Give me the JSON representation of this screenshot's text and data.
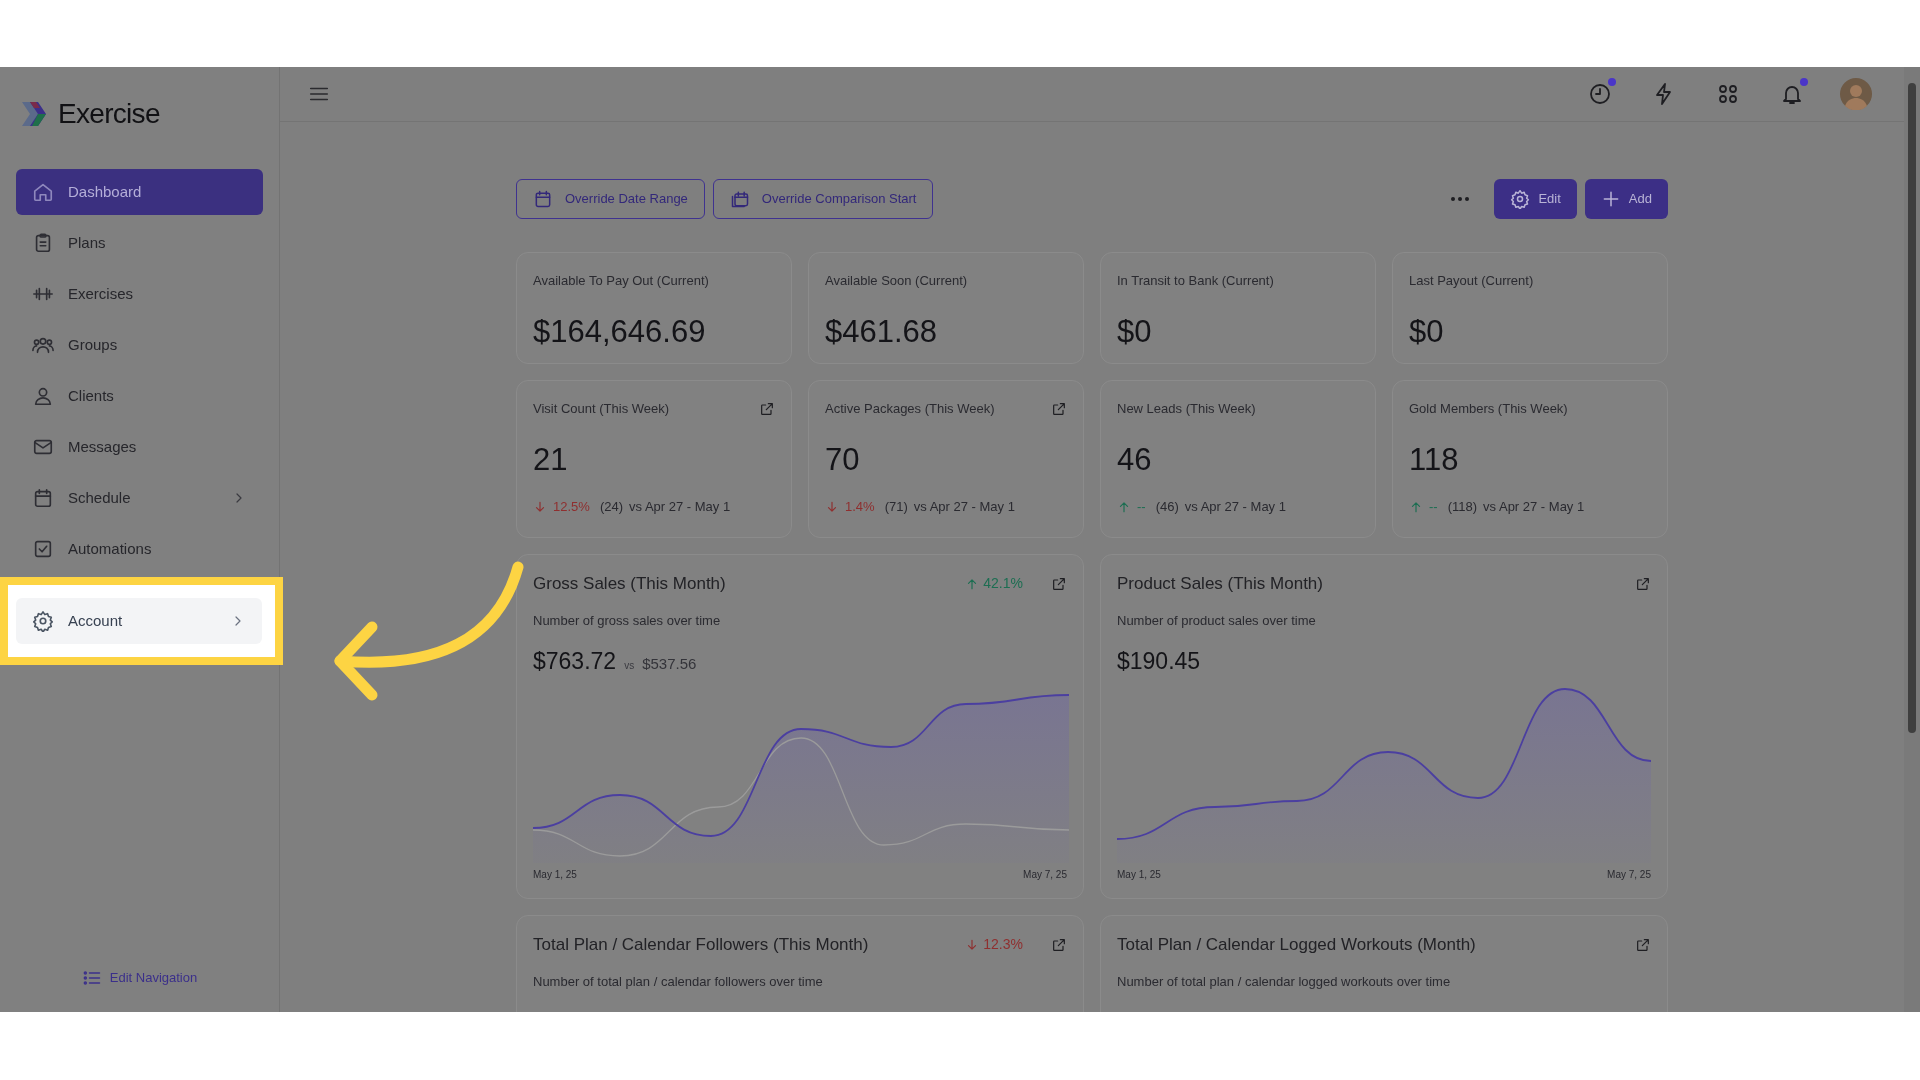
{
  "brand": {
    "name": "Exercise"
  },
  "sidebar": {
    "items": [
      {
        "label": "Dashboard",
        "kind": "home",
        "selected": true,
        "submenu": false,
        "highlighted": false
      },
      {
        "label": "Plans",
        "kind": "clipboard",
        "selected": false,
        "submenu": false,
        "highlighted": false
      },
      {
        "label": "Exercises",
        "kind": "dumbbell",
        "selected": false,
        "submenu": false,
        "highlighted": false
      },
      {
        "label": "Groups",
        "kind": "users",
        "selected": false,
        "submenu": false,
        "highlighted": false
      },
      {
        "label": "Clients",
        "kind": "user",
        "selected": false,
        "submenu": false,
        "highlighted": false
      },
      {
        "label": "Messages",
        "kind": "mail",
        "selected": false,
        "submenu": false,
        "highlighted": false
      },
      {
        "label": "Schedule",
        "kind": "calendar",
        "selected": false,
        "submenu": true,
        "highlighted": false
      },
      {
        "label": "Automations",
        "kind": "check",
        "selected": false,
        "submenu": false,
        "highlighted": false
      },
      {
        "label": "Account",
        "kind": "gear",
        "selected": false,
        "submenu": true,
        "highlighted": true
      }
    ],
    "footer": "Edit Navigation"
  },
  "header": {
    "icons": [
      {
        "kind": "clock",
        "badge": true
      },
      {
        "kind": "bolt",
        "badge": false
      },
      {
        "kind": "grid",
        "badge": false
      },
      {
        "kind": "bell",
        "badge": true
      }
    ]
  },
  "toolbar": {
    "buttons": [
      {
        "label": "Override Date Range",
        "kind": "calendar"
      },
      {
        "label": "Override Comparison Start",
        "kind": "calendars"
      }
    ],
    "actions": [
      {
        "label": "Edit",
        "kind": "gear"
      },
      {
        "label": "Add",
        "kind": "plus"
      }
    ]
  },
  "stat_cards": [
    {
      "title": "Available To Pay Out (Current)",
      "value": "$164,646.69"
    },
    {
      "title": "Available Soon (Current)",
      "value": "$461.68"
    },
    {
      "title": "In Transit to Bank (Current)",
      "value": "$0"
    },
    {
      "title": "Last Payout (Current)",
      "value": "$0"
    }
  ],
  "week_cards": [
    {
      "title": "Visit Count (This Week)",
      "link": true,
      "value": "21",
      "kind": "down",
      "change": "12.5%",
      "previous": "(24)",
      "comparison": "vs Apr 27 - May 1"
    },
    {
      "title": "Active Packages (This Week)",
      "link": true,
      "value": "70",
      "kind": "down",
      "change": "1.4%",
      "previous": "(71)",
      "comparison": "vs Apr 27 - May 1"
    },
    {
      "title": "New Leads (This Week)",
      "link": false,
      "value": "46",
      "kind": "up",
      "change": "--",
      "previous": "(46)",
      "comparison": "vs Apr 27 - May 1"
    },
    {
      "title": "Gold Members (This Week)",
      "link": false,
      "value": "118",
      "kind": "up",
      "change": "--",
      "previous": "(118)",
      "comparison": "vs Apr 27 - May 1"
    }
  ],
  "chart_cards": [
    {
      "title": "Gross Sales (This Month)",
      "kind": "up",
      "change": "42.1%",
      "subtitle": "Number of gross sales over time",
      "value": "$763.72",
      "vs": "vs",
      "comparison_value": "$537.56",
      "comparison_line": true,
      "x_start": "May 1, 25",
      "x_end": "May 7, 25"
    },
    {
      "title": "Product Sales (This Month)",
      "subtitle": "Number of product sales over time",
      "value": "$190.45",
      "comparison_line": false,
      "x_start": "May 1, 25",
      "x_end": "May 7, 25"
    }
  ],
  "bottom_cards": [
    {
      "title": "Total Plan / Calendar Followers (This Month)",
      "kind": "down",
      "change": "12.3%",
      "subtitle": "Number of total plan / calendar followers over time"
    },
    {
      "title": "Total Plan / Calendar Logged Workouts (Month)",
      "subtitle": "Number of total plan / calendar logged workouts over time"
    }
  ]
}
